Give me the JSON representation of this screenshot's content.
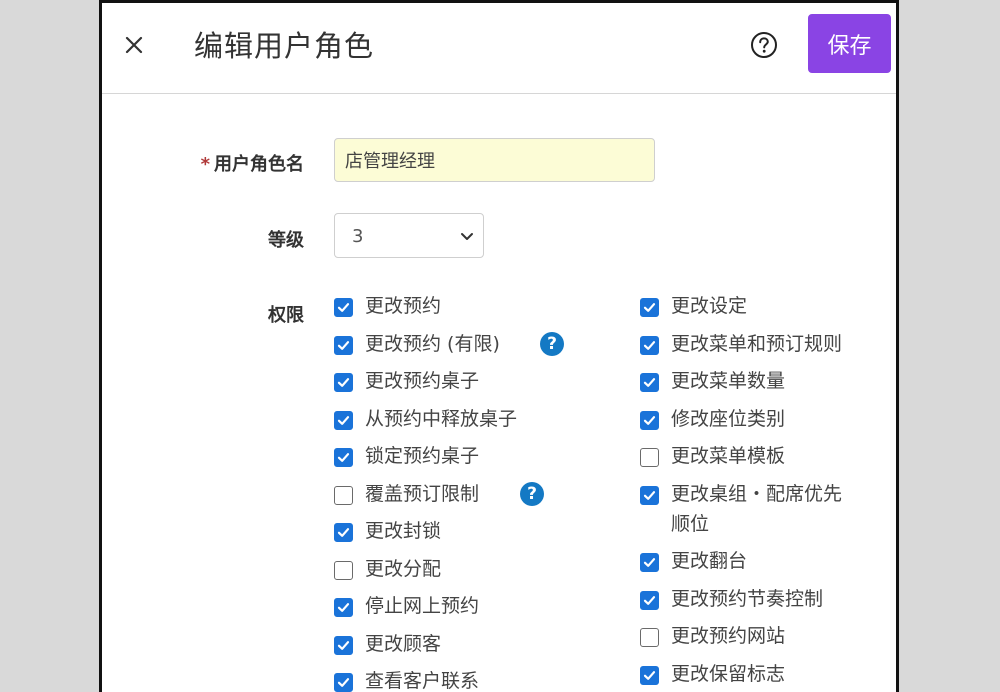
{
  "dialog": {
    "title": "编辑用户角色",
    "save_label": "保存"
  },
  "form": {
    "role_name_label": "用户角色名",
    "required_mark": "*",
    "role_name_value": "店管理经理",
    "level_label": "等级",
    "level_value": "3",
    "permissions_label": "权限"
  },
  "permissions_left": [
    {
      "label": "更改预约",
      "checked": true
    },
    {
      "label": "更改预约 (有限)",
      "checked": true,
      "help": true
    },
    {
      "label": "更改预约桌子",
      "checked": true
    },
    {
      "label": "从预约中释放桌子",
      "checked": true
    },
    {
      "label": "锁定预约桌子",
      "checked": true
    },
    {
      "label": "覆盖预订限制",
      "checked": false,
      "help": true
    },
    {
      "label": "更改封锁",
      "checked": true
    },
    {
      "label": "更改分配",
      "checked": false
    },
    {
      "label": "停止网上预约",
      "checked": true
    },
    {
      "label": "更改顾客",
      "checked": true
    },
    {
      "label": "查看客户联系",
      "checked": true
    }
  ],
  "permissions_right": [
    {
      "label": "更改设定",
      "checked": true
    },
    {
      "label": "更改菜单和预订规则",
      "checked": true
    },
    {
      "label": "更改菜单数量",
      "checked": true
    },
    {
      "label": "修改座位类别",
      "checked": true
    },
    {
      "label": "更改菜单模板",
      "checked": false
    },
    {
      "label": "更改桌组・配席优先\n顺位",
      "checked": true
    },
    {
      "label": "更改翻台",
      "checked": true
    },
    {
      "label": "更改预约节奏控制",
      "checked": true
    },
    {
      "label": "更改预约网站",
      "checked": false
    },
    {
      "label": "更改保留标志",
      "checked": true
    }
  ],
  "icons": {
    "close": "close-icon",
    "help": "question-circle-icon",
    "info": "question-badge-icon",
    "dropdown": "chevron-down-icon"
  },
  "colors": {
    "accent": "#8a44e4",
    "checkbox": "#1a73d9",
    "info_icon": "#1479c4",
    "input_bg": "#fcfcd6",
    "required": "#b03a3a"
  }
}
